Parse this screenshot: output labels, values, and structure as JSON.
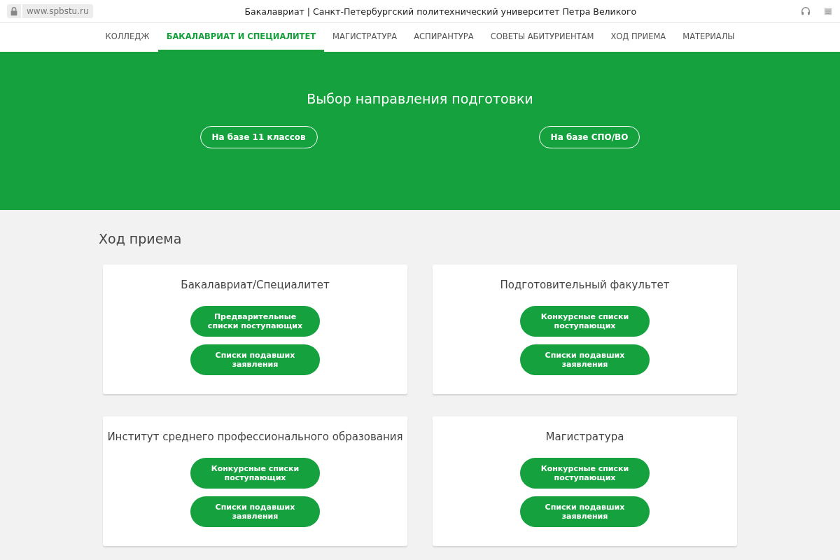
{
  "browser": {
    "address": "www.spbstu.ru",
    "title": "Бакалавриат | Санкт-Петербургский политехнический университет Петра Великого"
  },
  "nav": [
    {
      "label": "КОЛЛЕДЖ",
      "selected": false
    },
    {
      "label": "БАКАЛАВРИАТ И СПЕЦИАЛИТЕТ",
      "selected": true
    },
    {
      "label": "МАГИСТРАТУРА",
      "selected": false
    },
    {
      "label": "АСПИРАНТУРА",
      "selected": false
    },
    {
      "label": "СОВЕТЫ АБИТУРИЕНТАМ",
      "selected": false
    },
    {
      "label": "ХОД ПРИЕМА",
      "selected": false
    },
    {
      "label": "МАТЕРИАЛЫ",
      "selected": false
    }
  ],
  "hero": {
    "title": "Выбор направления подготовки",
    "buttons": [
      "На базе 11 классов",
      "На базе СПО/ВО"
    ]
  },
  "section": {
    "title": "Ход приема",
    "cards": [
      {
        "title": "Бакалавриат/Специалитет",
        "buttons": [
          "Предварительные списки поступающих",
          "Списки подавших заявления"
        ]
      },
      {
        "title": "Подготовительный факультет",
        "buttons": [
          "Конкурсные списки поступающих",
          "Списки подавших заявления"
        ]
      },
      {
        "title": "Институт среднего профессионального образования",
        "buttons": [
          "Конкурсные списки поступающих",
          "Списки подавших заявления"
        ]
      },
      {
        "title": "Магистратура",
        "buttons": [
          "Конкурсные списки поступающих",
          "Списки подавших заявления"
        ]
      }
    ]
  }
}
